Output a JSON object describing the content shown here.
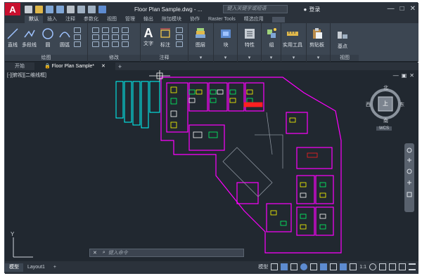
{
  "app": {
    "logo": "A",
    "title": "Floor Plan Sample.dwg - ...",
    "search_placeholder": "键入关键字或短语",
    "login": "登录"
  },
  "ribbon_tabs": [
    "默认",
    "插入",
    "注释",
    "参数化",
    "视图",
    "管理",
    "输出",
    "附加模块",
    "协作",
    "Raster Tools",
    "精选应用"
  ],
  "groups": {
    "draw": {
      "label": "绘图",
      "buttons": [
        "直线",
        "多段线",
        "圆",
        "圆弧"
      ]
    },
    "modify": {
      "label": "修改"
    },
    "annotation": {
      "label": "注释",
      "buttons": [
        "文字",
        "标注"
      ]
    },
    "layer": "图层",
    "block": "块",
    "properties": "特性",
    "group": "组",
    "utilities": "实用工具",
    "clipboard": "剪贴板",
    "base": "基点",
    "view": "视图"
  },
  "doc_tabs": [
    "开始",
    "Floor Plan Sample*"
  ],
  "viewport": {
    "label": "[-][俯视][二维线框]",
    "viewcube": {
      "north": "北",
      "south": "南",
      "east": "东",
      "west": "西",
      "top": "上",
      "wcs": "WCS"
    },
    "axis_y": "Y"
  },
  "command": {
    "placeholder": "键入命令"
  },
  "layout_tabs": [
    "模型",
    "Layout1"
  ],
  "status": {
    "model": "模型",
    "scale": "1:1"
  },
  "colors": {
    "accent": "#c8102e",
    "magenta": "#ff00ff",
    "cyan": "#00ffff",
    "yellow": "#ffff00",
    "green": "#00ff66",
    "red": "#ff2020"
  }
}
